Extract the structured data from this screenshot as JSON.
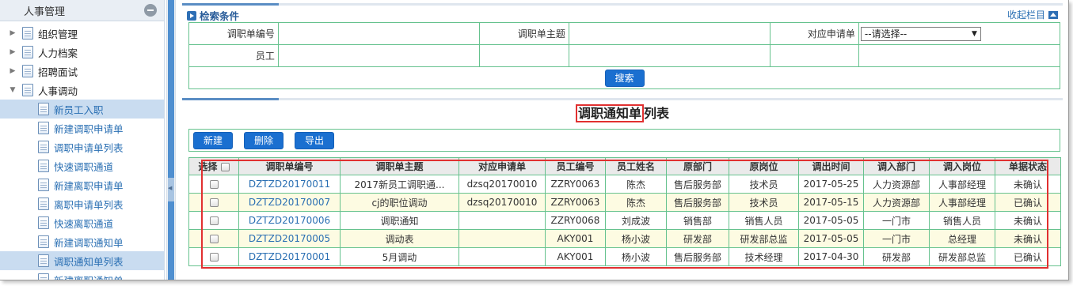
{
  "sidebar": {
    "title": "人事管理",
    "items": [
      {
        "label": "组织管理",
        "expanded": false
      },
      {
        "label": "人力档案",
        "expanded": false
      },
      {
        "label": "招聘面试",
        "expanded": false
      },
      {
        "label": "人事调动",
        "expanded": true
      }
    ],
    "children": [
      {
        "label": "新员工入职",
        "active": true
      },
      {
        "label": "新建调职申请单",
        "active": false
      },
      {
        "label": "调职申请单列表",
        "active": false
      },
      {
        "label": "快速调职通道",
        "active": false
      },
      {
        "label": "新建离职申请单",
        "active": false
      },
      {
        "label": "离职申请单列表",
        "active": false
      },
      {
        "label": "快速离职通道",
        "active": false
      },
      {
        "label": "新建调职通知单",
        "active": false
      },
      {
        "label": "调职通知单列表",
        "active": true
      },
      {
        "label": "新建离职通知单",
        "active": false
      }
    ]
  },
  "search": {
    "title": "检索条件",
    "collapse_label": "收起栏目",
    "label_doc_no": "调职单编号",
    "label_subject": "调职单主题",
    "label_request": "对应申请单",
    "label_employee": "员工",
    "request_selected": "--请选择--",
    "button_label": "搜索"
  },
  "list": {
    "title_highlight": "调职通知单",
    "title_rest": "列表",
    "toolbar": {
      "new": "新建",
      "delete": "删除",
      "export": "导出"
    },
    "columns": [
      "选择",
      "调职单编号",
      "调职单主题",
      "对应申请单",
      "员工编号",
      "员工姓名",
      "原部门",
      "原岗位",
      "调出时间",
      "调入部门",
      "调入岗位",
      "单据状态"
    ],
    "rows": [
      {
        "no": "DZTZD20170011",
        "subject": "2017新员工调职通...",
        "request": "dzsq20170010",
        "emp_no": "ZZRY0063",
        "name": "陈杰",
        "from_dept": "售后服务部",
        "from_post": "技术员",
        "date": "2017-05-25",
        "to_dept": "人力资源部",
        "to_post": "人事部经理",
        "status": "未确认"
      },
      {
        "no": "DZTZD20170007",
        "subject": "cj的职位调动",
        "request": "dzsq20170010",
        "emp_no": "ZZRY0063",
        "name": "陈杰",
        "from_dept": "售后服务部",
        "from_post": "技术员",
        "date": "2017-05-15",
        "to_dept": "人力资源部",
        "to_post": "人事部经理",
        "status": "已确认"
      },
      {
        "no": "DZTZD20170006",
        "subject": "调职通知",
        "request": "",
        "emp_no": "ZZRY0068",
        "name": "刘成波",
        "from_dept": "销售部",
        "from_post": "销售人员",
        "date": "2017-05-05",
        "to_dept": "一门市",
        "to_post": "销售人员",
        "status": "未确认"
      },
      {
        "no": "DZTZD20170005",
        "subject": "调动表",
        "request": "",
        "emp_no": "AKY001",
        "name": "杨小波",
        "from_dept": "研发部",
        "from_post": "研发部总监",
        "date": "2017-05-05",
        "to_dept": "一门市",
        "to_post": "总经理",
        "status": "未确认"
      },
      {
        "no": "DZTZD20170001",
        "subject": "5月调动",
        "request": "",
        "emp_no": "AKY001",
        "name": "杨小波",
        "from_dept": "售后服务部",
        "from_post": "技术经理",
        "date": "2017-04-30",
        "to_dept": "研发部",
        "to_post": "研发部总监",
        "status": "已确认"
      }
    ]
  },
  "colors": {
    "accent": "#1a6fd0",
    "grid_border": "#66c28e",
    "highlight": "#e13030",
    "link": "#2a6fb3"
  }
}
